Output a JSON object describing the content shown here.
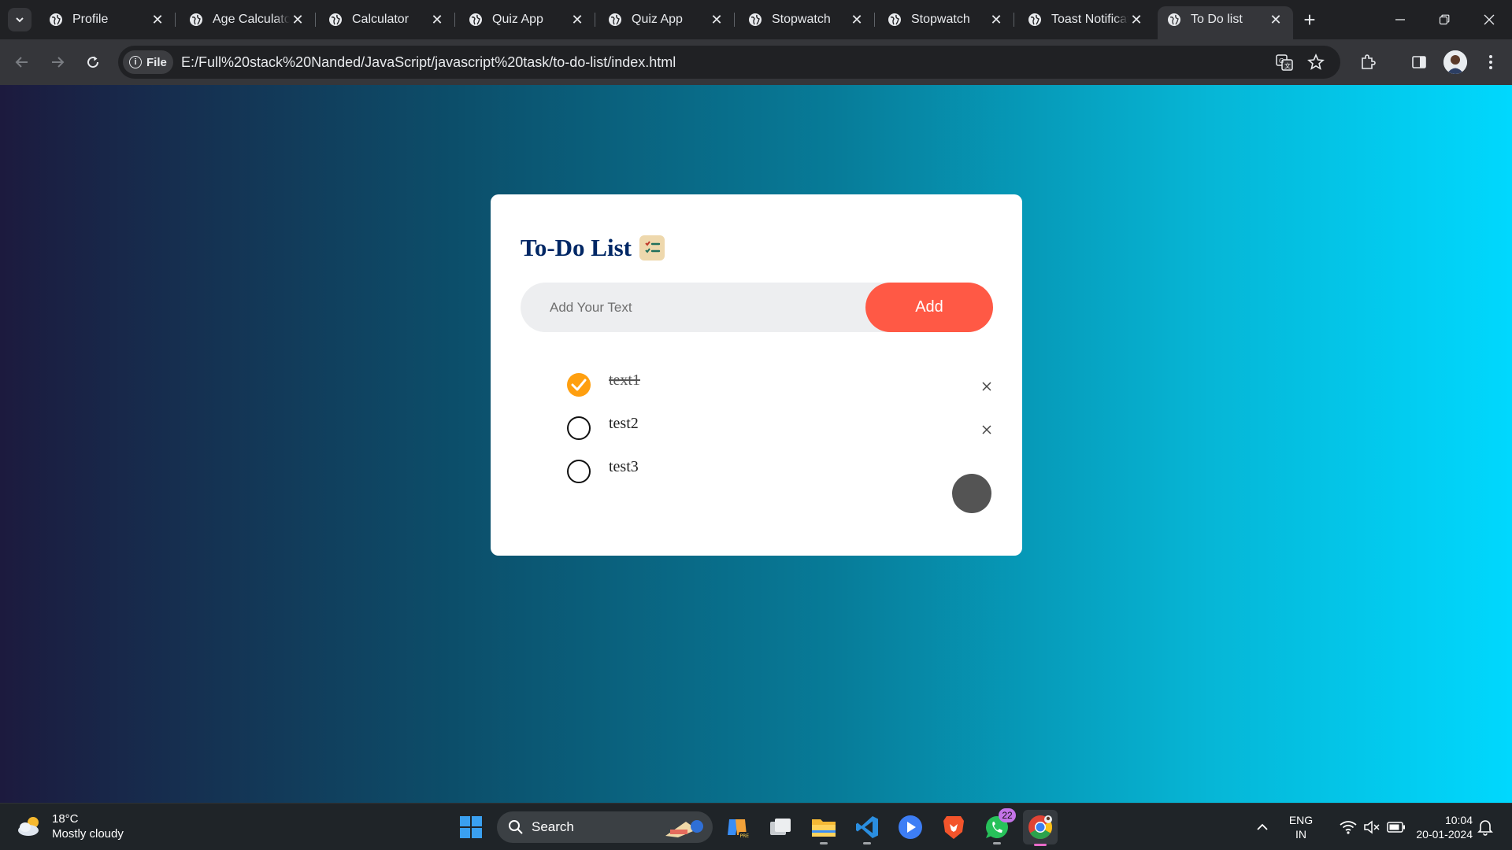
{
  "browser": {
    "tabs": [
      {
        "label": "Profile"
      },
      {
        "label": "Age Calculator"
      },
      {
        "label": "Calculator"
      },
      {
        "label": "Quiz App"
      },
      {
        "label": "Quiz App"
      },
      {
        "label": "Stopwatch"
      },
      {
        "label": "Stopwatch"
      },
      {
        "label": "Toast Notification"
      },
      {
        "label": "To Do list",
        "active": true
      }
    ],
    "site_chip_label": "File",
    "url": "E:/Full%20stack%20Nanded/JavaScript/javascript%20task/to-do-list/index.html"
  },
  "app": {
    "title": "To-Do List",
    "input_placeholder": "Add Your Text",
    "input_value": "",
    "add_button_label": "Add",
    "tasks": [
      {
        "text": "text1",
        "checked": true
      },
      {
        "text": "test2",
        "checked": false
      },
      {
        "text": "test3",
        "checked": false
      }
    ],
    "colors": {
      "accent": "#ff5945",
      "check": "#ff9f0f",
      "title": "#002765"
    }
  },
  "taskbar": {
    "weather_temp": "18°C",
    "weather_desc": "Mostly cloudy",
    "search_label": "Search",
    "whatsapp_badge": "22",
    "lang_top": "ENG",
    "lang_bottom": "IN",
    "time": "10:04",
    "date": "20-01-2024"
  }
}
